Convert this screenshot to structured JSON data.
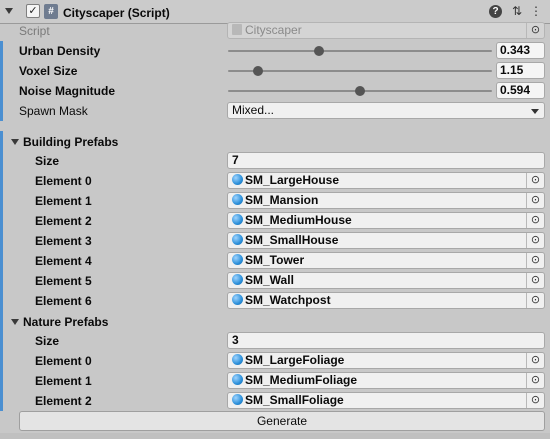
{
  "header": {
    "title": "Cityscaper (Script)",
    "script_glyph": "#",
    "check_glyph": "✓",
    "help_glyph": "?",
    "settings_glyph": "⇅",
    "menu_glyph": "⋮"
  },
  "script": {
    "label": "Script",
    "value": "Cityscaper"
  },
  "sliders": [
    {
      "label": "Urban Density",
      "value": "0.343",
      "fraction": 0.343
    },
    {
      "label": "Voxel Size",
      "value": "1.15",
      "fraction": 0.115
    },
    {
      "label": "Noise Magnitude",
      "value": "0.594",
      "fraction": 0.5
    }
  ],
  "spawn_mask": {
    "label": "Spawn Mask",
    "value": "Mixed..."
  },
  "building_prefabs": {
    "label": "Building Prefabs",
    "size_label": "Size",
    "size": "7",
    "elements": [
      {
        "label": "Element 0",
        "value": "SM_LargeHouse"
      },
      {
        "label": "Element 1",
        "value": "SM_Mansion"
      },
      {
        "label": "Element 2",
        "value": "SM_MediumHouse"
      },
      {
        "label": "Element 3",
        "value": "SM_SmallHouse"
      },
      {
        "label": "Element 4",
        "value": "SM_Tower"
      },
      {
        "label": "Element 5",
        "value": "SM_Wall"
      },
      {
        "label": "Element 6",
        "value": "SM_Watchpost"
      }
    ]
  },
  "nature_prefabs": {
    "label": "Nature Prefabs",
    "size_label": "Size",
    "size": "3",
    "elements": [
      {
        "label": "Element 0",
        "value": "SM_LargeFoliage"
      },
      {
        "label": "Element 1",
        "value": "SM_MediumFoliage"
      },
      {
        "label": "Element 2",
        "value": "SM_SmallFoliage"
      }
    ]
  },
  "picker_glyph": "⊙",
  "generate_label": "Generate",
  "colors": {
    "accent": "#4b8fd1",
    "background": "#c8c8c8",
    "field": "#f0f0f0"
  }
}
